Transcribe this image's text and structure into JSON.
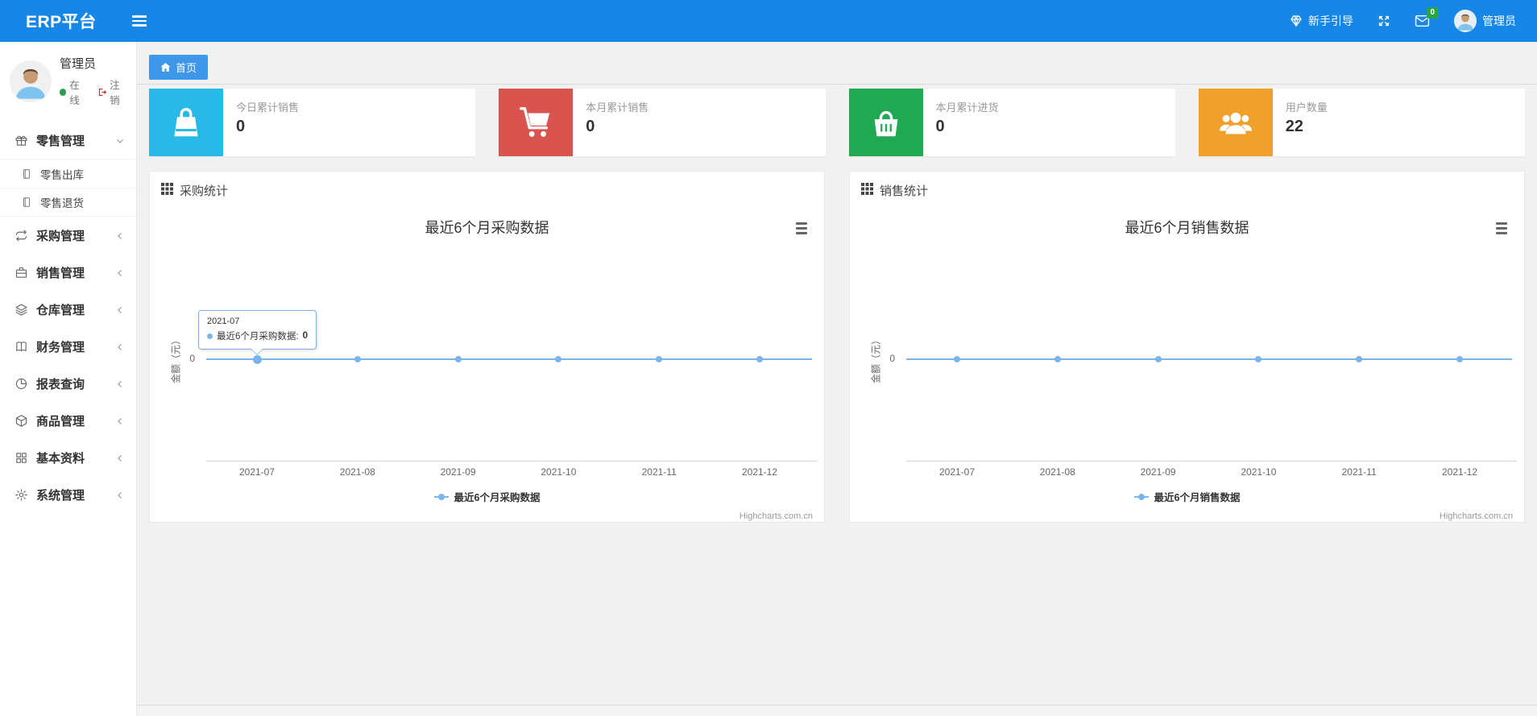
{
  "navbar": {
    "brand": "ERP平台",
    "guide_label": "新手引导",
    "mail_badge": "0",
    "user_name": "管理员"
  },
  "sidebar": {
    "user": {
      "name": "管理员",
      "status": "在线",
      "logout": "注销"
    },
    "items": [
      {
        "icon": "gift-icon",
        "label": "零售管理",
        "state": "expanded",
        "children": [
          {
            "icon": "doc-icon",
            "label": "零售出库"
          },
          {
            "icon": "doc-icon",
            "label": "零售退货"
          }
        ]
      },
      {
        "icon": "loop-icon",
        "label": "采购管理",
        "state": "collapsed"
      },
      {
        "icon": "briefcase-icon",
        "label": "销售管理",
        "state": "collapsed"
      },
      {
        "icon": "layers-icon",
        "label": "仓库管理",
        "state": "collapsed"
      },
      {
        "icon": "book-icon",
        "label": "财务管理",
        "state": "collapsed"
      },
      {
        "icon": "pie-icon",
        "label": "报表查询",
        "state": "collapsed"
      },
      {
        "icon": "cube-icon",
        "label": "商品管理",
        "state": "collapsed"
      },
      {
        "icon": "grid-icon",
        "label": "基本资料",
        "state": "collapsed"
      },
      {
        "icon": "gear-icon",
        "label": "系统管理",
        "state": "collapsed"
      }
    ]
  },
  "tabs": [
    {
      "label": "首页",
      "icon": "home-icon",
      "active": true
    }
  ],
  "stat_cards": [
    {
      "label": "今日累计销售",
      "value": "0",
      "icon": "shopping-bag-icon",
      "color": "#29b9e8"
    },
    {
      "label": "本月累计销售",
      "value": "0",
      "icon": "cart-icon",
      "color": "#d9534f"
    },
    {
      "label": "本月累计进货",
      "value": "0",
      "icon": "basket-icon",
      "color": "#20a853"
    },
    {
      "label": "用户数量",
      "value": "22",
      "icon": "users-icon",
      "color": "#f0a12c"
    }
  ],
  "panels": [
    {
      "title": "采购统计"
    },
    {
      "title": "销售统计"
    }
  ],
  "chart_data": [
    {
      "type": "line",
      "title": "最近6个月采购数据",
      "categories": [
        "2021-07",
        "2021-08",
        "2021-09",
        "2021-10",
        "2021-11",
        "2021-12"
      ],
      "series": [
        {
          "name": "最近6个月采购数据",
          "values": [
            0,
            0,
            0,
            0,
            0,
            0
          ]
        }
      ],
      "xlabel": "",
      "ylabel": "金额（元）",
      "y_tick_labels": [
        "0"
      ],
      "grid": false,
      "legend_position": "bottom",
      "line_color": "#7cb5ec",
      "credits": "Highcharts.com.cn",
      "tooltip": {
        "visible": true,
        "category": "2021-07",
        "series": "最近6个月采购数据",
        "value": "0"
      }
    },
    {
      "type": "line",
      "title": "最近6个月销售数据",
      "categories": [
        "2021-07",
        "2021-08",
        "2021-09",
        "2021-10",
        "2021-11",
        "2021-12"
      ],
      "series": [
        {
          "name": "最近6个月销售数据",
          "values": [
            0,
            0,
            0,
            0,
            0,
            0
          ]
        }
      ],
      "xlabel": "",
      "ylabel": "金额（元）",
      "y_tick_labels": [
        "0"
      ],
      "grid": false,
      "legend_position": "bottom",
      "line_color": "#7cb5ec",
      "credits": "Highcharts.com.cn",
      "tooltip": {
        "visible": false
      }
    }
  ],
  "colors": {
    "navbar": "#1787e7",
    "tab_active": "#3f97ea",
    "badge": "#27a744",
    "status_online": "#2d9e49",
    "logout_red": "#c9302c",
    "chart_line": "#7cb5ec",
    "axis_line": "#ccd6eb"
  }
}
